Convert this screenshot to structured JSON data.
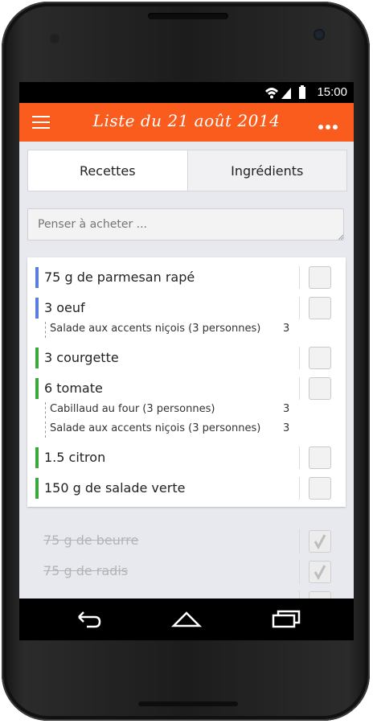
{
  "status": {
    "time": "15:00"
  },
  "appbar": {
    "title": "Liste du 21 août 2014"
  },
  "tabs": [
    {
      "label": "Recettes"
    },
    {
      "label": "Ingrédients"
    }
  ],
  "add_field": {
    "placeholder": "Penser à acheter ..."
  },
  "items": [
    {
      "name": "75 g de parmesan rapé",
      "color": "#5b7de0",
      "recipes": []
    },
    {
      "name": "3 oeuf",
      "color": "#5b7de0",
      "recipes": [
        {
          "recipe": "Salade aux accents niçois (3 personnes)",
          "count": "3"
        }
      ]
    },
    {
      "name": "3 courgette",
      "color": "#3aa83a",
      "recipes": []
    },
    {
      "name": "6 tomate",
      "color": "#3aa83a",
      "recipes": [
        {
          "recipe": "Cabillaud au four (3 personnes)",
          "count": "3"
        },
        {
          "recipe": "Salade aux accents niçois (3 personnes)",
          "count": "3"
        }
      ]
    },
    {
      "name": "1.5 citron",
      "color": "#3aa83a",
      "recipes": []
    },
    {
      "name": "150 g de salade verte",
      "color": "#3aa83a",
      "recipes": []
    }
  ],
  "done_items": [
    {
      "name": "75 g de beurre"
    },
    {
      "name": "75 g de radis"
    }
  ]
}
